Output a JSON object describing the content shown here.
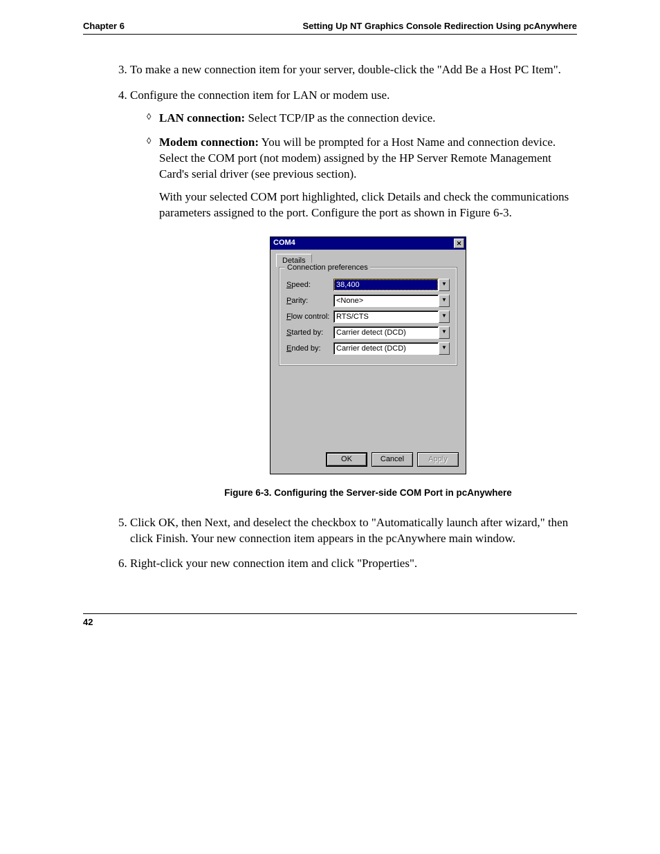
{
  "header": {
    "left": "Chapter 6",
    "right": "Setting Up NT Graphics Console Redirection Using pcAnywhere"
  },
  "list": {
    "item3": "To make a new connection item for your server, double-click the \"Add Be a Host PC Item\".",
    "item4": "Configure the connection item for LAN or modem use.",
    "item4_sub1_bold": "LAN connection:",
    "item4_sub1_rest": " Select TCP/IP as the connection device.",
    "item4_sub2_bold": "Modem connection:",
    "item4_sub2_rest": " You will be prompted for a Host Name and connection device. Select the COM port (not modem) assigned by the HP Server Remote Management Card's serial driver (see previous section).",
    "item4_sub2_p2": "With your selected COM port highlighted, click Details and check the communications parameters assigned to the port. Configure the port as shown in Figure 6-3.",
    "item5": "Click OK, then Next, and deselect the checkbox to \"Automatically launch after wizard,\" then click Finish. Your new connection item appears in the pcAnywhere main window.",
    "item6": "Right-click your new connection item and click \"Properties\"."
  },
  "dialog": {
    "title": "COM4",
    "tab": "Details",
    "group": "Connection preferences",
    "labels": {
      "speed_s": "S",
      "speed_rest": "peed:",
      "parity_p": "P",
      "parity_rest": "arity:",
      "flow_f": "F",
      "flow_rest": "low control:",
      "started_s": "S",
      "started_rest": "tarted by:",
      "ended_e": "E",
      "ended_rest": "nded by:"
    },
    "values": {
      "speed": "38,400",
      "parity": "<None>",
      "flow": "RTS/CTS",
      "started": "Carrier detect (DCD)",
      "ended": "Carrier detect (DCD)"
    },
    "buttons": {
      "ok": "OK",
      "cancel": "Cancel",
      "apply": "Apply"
    }
  },
  "caption": "Figure 6-3.  Configuring the Server-side COM Port in pcAnywhere",
  "footer": {
    "page": "42"
  }
}
